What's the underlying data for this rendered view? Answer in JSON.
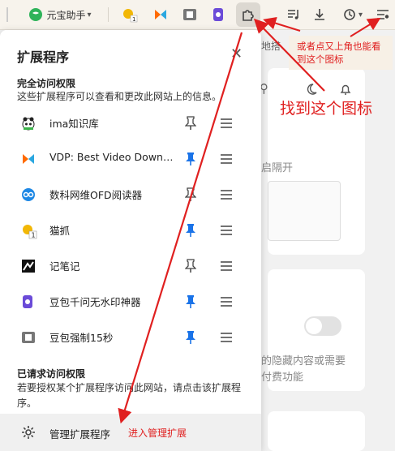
{
  "toolbar": {
    "yuanbao_label": "元宝助手"
  },
  "page_bg": {
    "text1": "地搭",
    "text2": "启隔开",
    "text3": "的隐藏内容或需要",
    "text4": "付费功能"
  },
  "popup": {
    "title": "扩展程序",
    "full_access_title": "完全访问权限",
    "full_access_desc": "这些扩展程序可以查看和更改此网站上的信息。",
    "extensions": [
      {
        "name": "ima知识库",
        "pinned": false
      },
      {
        "name": "VDP: Best Video Downlo...",
        "pinned": true
      },
      {
        "name": "数科网维OFD阅读器",
        "pinned": false
      },
      {
        "name": "猫抓",
        "pinned": true
      },
      {
        "name": "记笔记",
        "pinned": false
      },
      {
        "name": "豆包千问无水印神器",
        "pinned": true
      },
      {
        "name": "豆包强制15秒",
        "pinned": true
      }
    ],
    "requested_title": "已请求访问权限",
    "requested_desc": "若要授权某个扩展程序访问此网站，请点击该扩展程序。",
    "manage_label": "管理扩展程序"
  },
  "annotations": {
    "find_icon": "找到这个图标",
    "or_click": "或者点又上角也能看到这个图标",
    "enter_manage": "进入管理扩展"
  },
  "colors": {
    "accent_blue": "#1a73e8",
    "annotation_red": "#e02020"
  }
}
